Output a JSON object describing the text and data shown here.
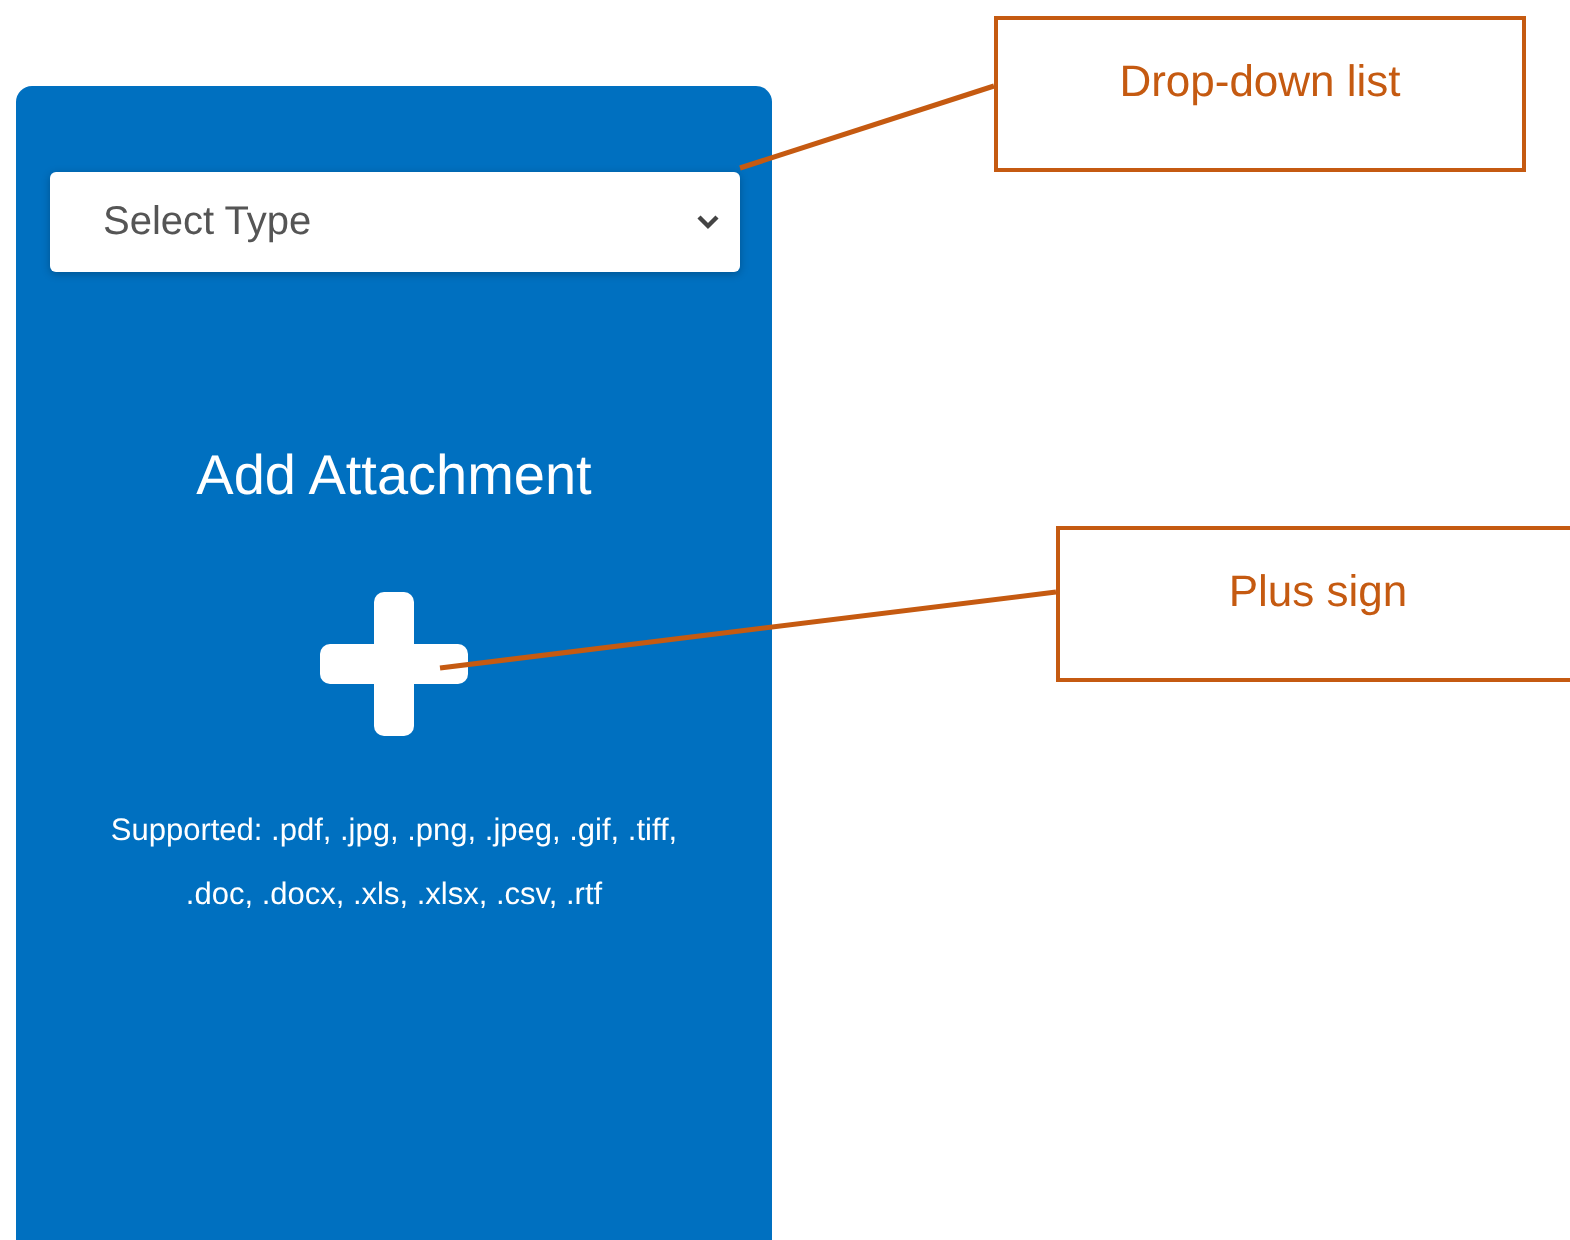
{
  "card": {
    "select": {
      "placeholder": "Select Type"
    },
    "title": "Add Attachment",
    "supported": "Supported: .pdf, .jpg, .png, .jpeg, .gif, .tiff, .doc, .docx, .xls, .xlsx, .csv, .rtf"
  },
  "callouts": [
    {
      "label": "Drop-down list"
    },
    {
      "label": "Plus sign"
    }
  ]
}
